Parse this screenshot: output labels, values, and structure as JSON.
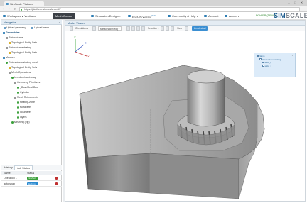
{
  "browser": {
    "tab_title": "SimScale Platform",
    "url": "https://platform.simscale.de/#!/",
    "window_controls": [
      "–",
      "□",
      "✕"
    ]
  },
  "menu": {
    "items": [
      {
        "label": "Workspace  ▸  Ventilator",
        "icon": "workspace-icon"
      },
      {
        "label": "Mesh Creator",
        "active": true
      },
      {
        "label": "Simulation Designer",
        "icon": "simulation-icon"
      },
      {
        "label": "Post-Processor",
        "badge": "BETA",
        "icon": "post-icon"
      },
      {
        "label": "Community & Help ▾",
        "icon": "community-icon"
      },
      {
        "label": "Account ▾",
        "icon": "account-icon"
      },
      {
        "label": "Admin ▾",
        "icon": "admin-icon"
      }
    ],
    "power_label": "POWER (TRIAL)",
    "logo": {
      "part1": "SIM",
      "part2": "SCALE"
    }
  },
  "left_panel": {
    "title": "Navigator",
    "buttons": [
      "Upload geometry",
      "Upload mesh"
    ],
    "tree": [
      {
        "label": "Geometries",
        "level": 0,
        "bold": true,
        "marker": "sq"
      },
      {
        "label": "Rotorvolume",
        "level": 1,
        "marker": "gr"
      },
      {
        "label": "Topological Entity Sets",
        "level": 2,
        "marker": "yl"
      },
      {
        "label": "Rotorvolumestrating",
        "level": 1,
        "marker": "gr"
      },
      {
        "label": "Topological Entity Sets",
        "level": 2,
        "marker": "yl"
      },
      {
        "label": "Meshes",
        "level": 0,
        "bold": false,
        "marker": "sq"
      },
      {
        "label": "Rotorvolumestrating mesh",
        "level": 1,
        "marker": "gd"
      },
      {
        "label": "Topological Entity Sets",
        "level": 2,
        "marker": "yl"
      },
      {
        "label": "Mesh Operations",
        "level": 2,
        "marker": "gr"
      },
      {
        "label": "hex-dominant-snap",
        "level": 3,
        "marker": "gd"
      },
      {
        "label": "Geometry Primitives",
        "level": 4,
        "marker": "gr"
      },
      {
        "label": "_BaseMeshBox",
        "level": 5,
        "marker": "gd"
      },
      {
        "label": "Cylinder",
        "level": 5,
        "marker": "gd"
      },
      {
        "label": "Mesh Refinements",
        "level": 4,
        "marker": "gr"
      },
      {
        "label": "rotating-zone",
        "level": 5,
        "marker": "gd"
      },
      {
        "label": "surfaceref",
        "level": 5,
        "marker": "gd"
      },
      {
        "label": "volumeref",
        "level": 5,
        "marker": "gd"
      },
      {
        "label": "layers",
        "level": 5,
        "marker": "gd"
      },
      {
        "label": "Meshing (zip)",
        "level": 3,
        "marker": "gd"
      }
    ],
    "job_tabs": [
      "History",
      "Job Status"
    ],
    "job_columns": [
      "Name",
      "Status"
    ],
    "jobs": [
      {
        "name": "Operation 1",
        "status": "Finished",
        "color": "#3aa03a",
        "fill": 0.35
      },
      {
        "name": "auto-snap",
        "status": "Meshing",
        "color": "#2a8ad0",
        "fill": 0.35
      }
    ]
  },
  "viewer": {
    "title": "Model Viewer",
    "toolbar": {
      "orientation": "Orientation ▾",
      "surface": "surfaces with edg ▾",
      "select": "Selection ▾",
      "view": "View ▾",
      "unselect": "Unselect all"
    },
    "selection_box": {
      "title": "Name",
      "items": [
        "Rotorvolumestrating",
        "solid_0",
        "solid_1"
      ],
      "close": "✕"
    },
    "axes": {
      "x": "X",
      "y": "Y",
      "z": "Z"
    }
  }
}
